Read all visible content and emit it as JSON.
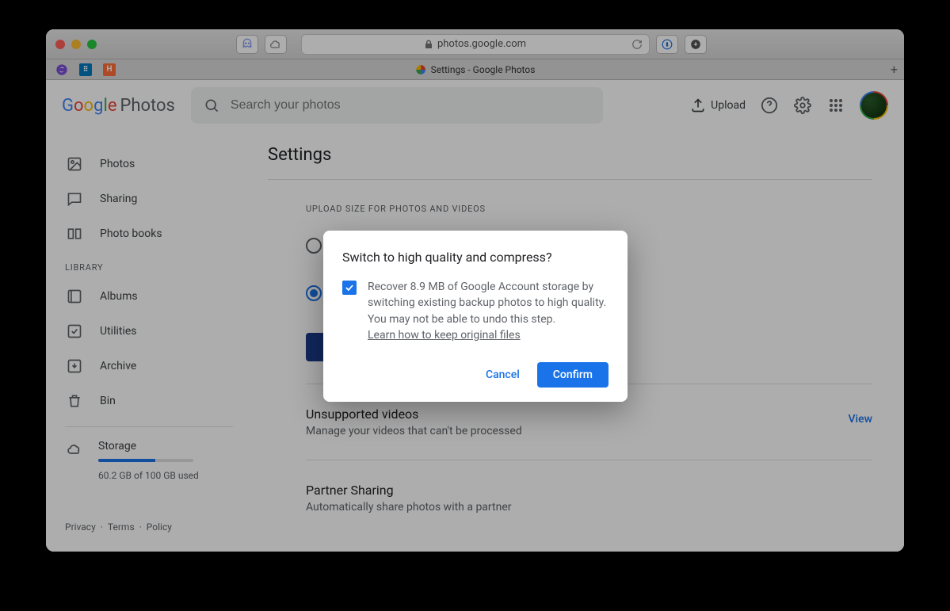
{
  "browser": {
    "address": "photos.google.com",
    "tab_title": "Settings - Google Photos"
  },
  "header": {
    "logo_product": "Photos",
    "search_placeholder": "Search your photos",
    "upload_label": "Upload"
  },
  "sidebar": {
    "items": [
      {
        "label": "Photos"
      },
      {
        "label": "Sharing"
      },
      {
        "label": "Photo books"
      }
    ],
    "library_label": "LIBRARY",
    "library_items": [
      {
        "label": "Albums"
      },
      {
        "label": "Utilities"
      },
      {
        "label": "Archive"
      },
      {
        "label": "Bin"
      }
    ],
    "storage": {
      "title": "Storage",
      "used_text": "60.2 GB of 100 GB used",
      "percent": 60.2
    },
    "footer": {
      "privacy": "Privacy",
      "terms": "Terms",
      "policy": "Policy"
    }
  },
  "page": {
    "title": "Settings",
    "upload_section_label": "UPLOAD SIZE FOR PHOTOS AND VIDEOS",
    "unsupported": {
      "title": "Unsupported videos",
      "subtitle": "Manage your videos that can't be processed",
      "action": "View"
    },
    "partner": {
      "title": "Partner Sharing",
      "subtitle": "Automatically share photos with a partner"
    }
  },
  "dialog": {
    "title": "Switch to high quality and compress?",
    "body": "Recover 8.9 MB of Google Account storage by switching existing backup photos to high quality. You may not be able to undo this step.",
    "link": "Learn how to keep original files",
    "cancel": "Cancel",
    "confirm": "Confirm"
  }
}
